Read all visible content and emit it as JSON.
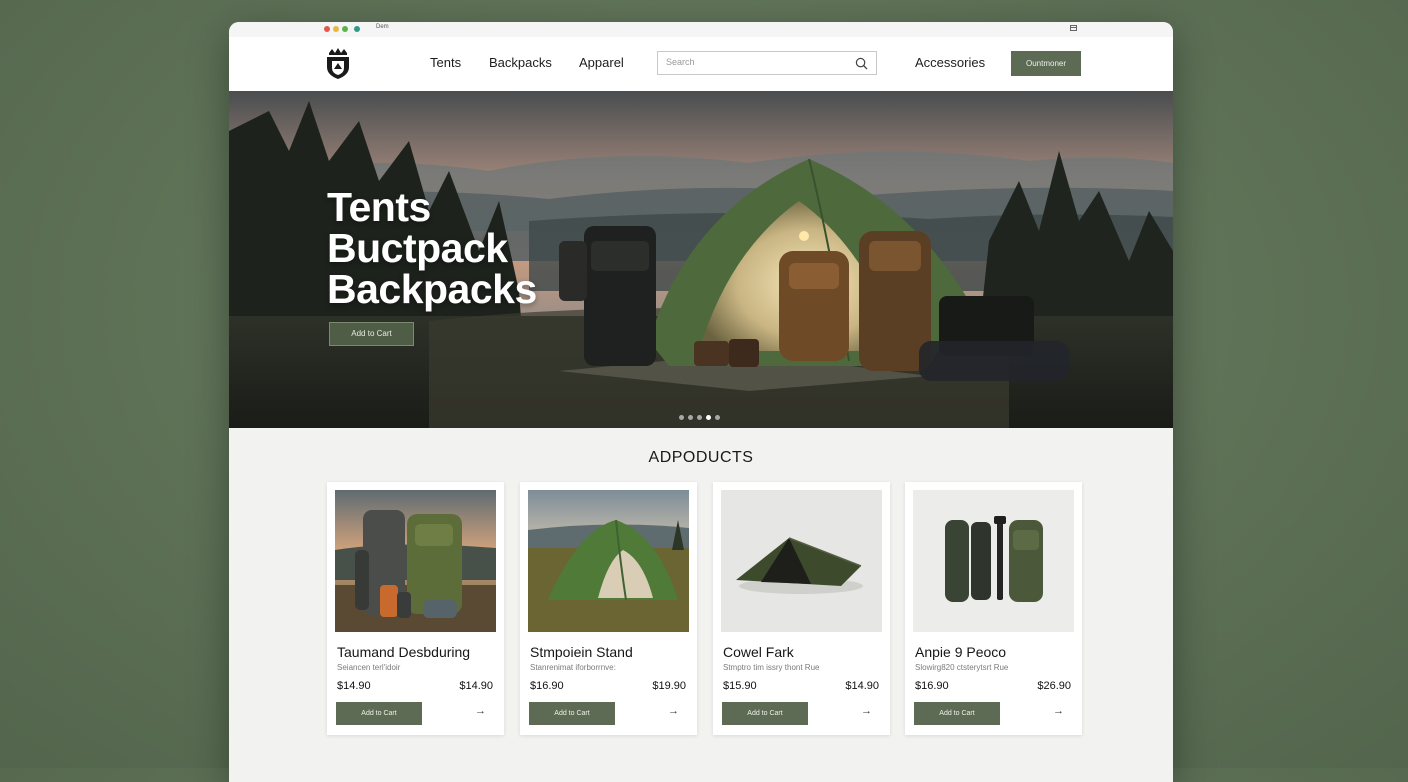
{
  "window": {
    "title": "Dem"
  },
  "nav": {
    "links": [
      "Tents",
      "Backpacks",
      "Apparel"
    ],
    "search_placeholder": "Search",
    "accessories_label": "Accessories",
    "cta_label": "Ountmoner"
  },
  "hero": {
    "title_lines": [
      "Tents",
      "Buctpack",
      "Backpacks"
    ],
    "button_label": "Add to Cart",
    "carousel_active_index": 3,
    "carousel_count": 5
  },
  "products_section": {
    "title": "ADPODUCTS"
  },
  "products": [
    {
      "name": "Taumand Desbduring",
      "subtitle": "Seiancen terl'idoir",
      "price": "$14.90",
      "price_alt": "$14.90",
      "button_label": "Add to Cart",
      "arrow": "→"
    },
    {
      "name": "Stmpoiein Stand",
      "subtitle": "Stanrenimat iforborrnve:",
      "price": "$16.90",
      "price_alt": "$19.90",
      "button_label": "Add to Cart",
      "arrow": "→"
    },
    {
      "name": "Cowel Fark",
      "subtitle": "Stmptro tim issry thont Rue",
      "price": "$15.90",
      "price_alt": "$14.90",
      "button_label": "Add to Cart",
      "arrow": "→"
    },
    {
      "name": "Anpie 9 Peoco",
      "subtitle": "Slowirg820 ctsterytsrt Rue",
      "price": "$16.90",
      "price_alt": "$26.90",
      "button_label": "Add to Cart",
      "arrow": "→"
    }
  ],
  "colors": {
    "accent": "#5e6b54",
    "page_background": "#5e7257",
    "window_background": "#f2f2f1"
  }
}
